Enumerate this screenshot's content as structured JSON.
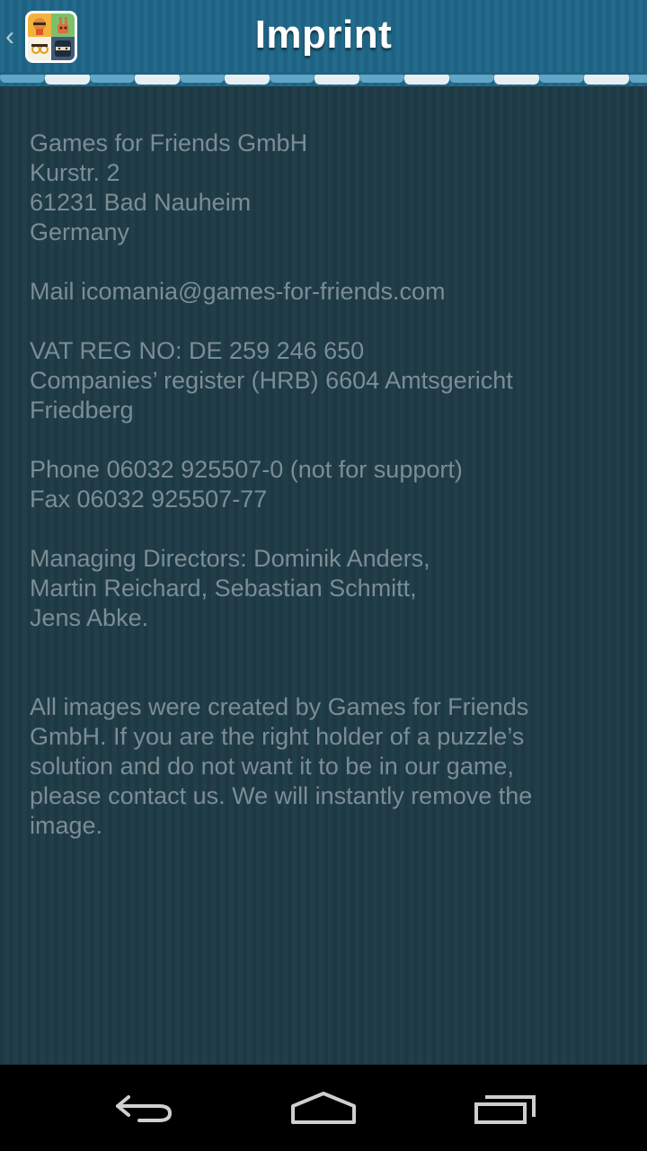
{
  "header": {
    "title": "Imprint",
    "back_icon": "chevron-left-icon",
    "app_icon": "icomania-app-icon"
  },
  "imprint": {
    "company": "Games for Friends GmbH",
    "street": "Kurstr. 2",
    "city": "61231 Bad Nauheim",
    "country": "Germany",
    "mail": "Mail icomania@games-for-friends.com",
    "vat": "VAT REG NO: DE 259 246 650",
    "register_line1": "Companies’ register (HRB) 6604 Amtsgericht",
    "register_line2": "Friedberg",
    "phone": "Phone 06032 925507-0 (not for support)",
    "fax": "Fax 06032 925507-77",
    "directors_line1": "Managing Directors: Dominik Anders,",
    "directors_line2": "Martin Reichard, Sebastian Schmitt,",
    "directors_line3": "Jens Abke.",
    "images_notice": "All images were created by Games for Friends GmbH. If you are the right holder of a puzzle’s solution and do not want it to be in our game, please contact us. We will instantly remove the image."
  },
  "navbar": {
    "back": "back-arrow-icon",
    "home": "home-icon",
    "recents": "recent-apps-icon"
  },
  "colors": {
    "header": "#236b8c",
    "background": "#1f3a44",
    "text": "#7b8d95"
  }
}
